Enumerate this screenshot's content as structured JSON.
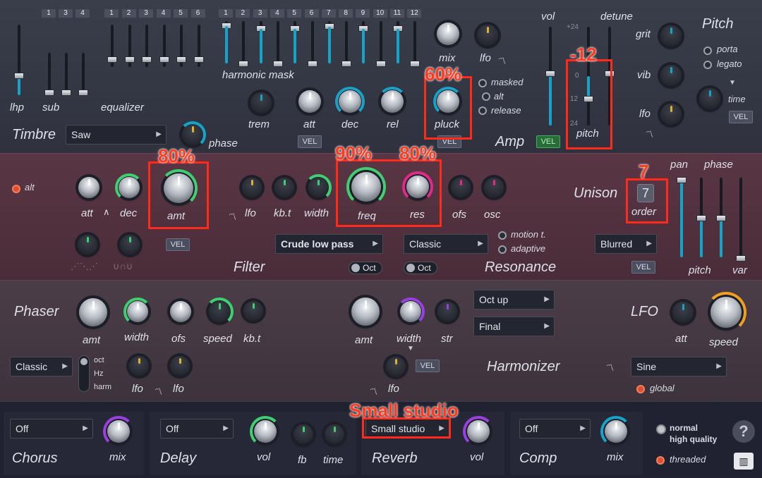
{
  "timbre": {
    "section": "Timbre",
    "lhp": "lhp",
    "sub": "sub",
    "equalizer": "equalizer",
    "harmonic_mask": "harmonic mask",
    "sub_tabs": [
      "1",
      "3",
      "4"
    ],
    "eq_tabs": [
      "1",
      "2",
      "3",
      "4",
      "5",
      "6"
    ],
    "hm_tabs": [
      "1",
      "2",
      "3",
      "4",
      "5",
      "6",
      "7",
      "8",
      "9",
      "10",
      "11",
      "12"
    ],
    "waveform": "Saw",
    "phase": "phase",
    "trem": "trem",
    "att": "att",
    "dec": "dec",
    "rel": "rel",
    "vel": "VEL"
  },
  "amp": {
    "section": "Amp",
    "mix": "mix",
    "lfo": "lfo",
    "pluck": "pluck",
    "masked": "masked",
    "alt": "alt",
    "release": "release",
    "vol": "vol",
    "vel": "VEL",
    "detune": "detune",
    "pitch": "pitch",
    "scale_top": "+24",
    "scale_mid": "+12",
    "scale_zero": "0",
    "scale_neg12": "12",
    "scale_bot": "24"
  },
  "pitch_sec": {
    "section": "Pitch",
    "grit": "grit",
    "vib": "vib",
    "lfo": "lfo",
    "porta": "porta",
    "legato": "legato",
    "time": "time",
    "vel": "VEL"
  },
  "filter": {
    "alt": "alt",
    "att": "att",
    "dec": "dec",
    "amt": "amt",
    "lfo": "lfo",
    "kbt": "kb.t",
    "width": "width",
    "freq": "freq",
    "res": "res",
    "ofs": "ofs",
    "osc": "osc",
    "vel": "VEL",
    "section": "Filter",
    "type": "Crude low pass",
    "oct": "Oct"
  },
  "resonance": {
    "section": "Resonance",
    "mode": "Classic",
    "oct": "Oct",
    "motion": "motion t.",
    "adaptive": "adaptive"
  },
  "unison": {
    "section": "Unison",
    "order_value": "7",
    "order": "order",
    "pan": "pan",
    "phase": "phase",
    "pitch": "pitch",
    "var": "var",
    "mode": "Blurred",
    "vel": "VEL"
  },
  "phaser": {
    "section": "Phaser",
    "amt": "amt",
    "width": "width",
    "ofs": "ofs",
    "speed": "speed",
    "kbt": "kb.t",
    "mode": "Classic",
    "oct": "oct",
    "hz": "Hz",
    "harm": "harm",
    "lfo": "lfo",
    "lfo2": "lfo"
  },
  "harmonizer": {
    "section": "Harmonizer",
    "amt": "amt",
    "width": "width",
    "str": "str",
    "lfo": "lfo",
    "vel": "VEL",
    "mode1": "Oct up",
    "mode2": "Final"
  },
  "lfo": {
    "section": "LFO",
    "att": "att",
    "speed": "speed",
    "shape": "Sine",
    "global": "global"
  },
  "fx": {
    "chorus": "Chorus",
    "chorus_val": "Off",
    "mix": "mix",
    "delay": "Delay",
    "delay_val": "Off",
    "vol": "vol",
    "fb": "fb",
    "time": "time",
    "reverb": "Reverb",
    "reverb_val": "Small studio",
    "rvol": "vol",
    "comp": "Comp",
    "comp_val": "Off",
    "cmix": "mix",
    "normal": "normal",
    "high_quality": "high quality",
    "threaded": "threaded",
    "help": "?"
  },
  "annotations": {
    "pluck": "60%",
    "pitch": "-12",
    "amt": "80%",
    "freq": "90%",
    "res": "80%",
    "order": "7",
    "reverb": "Small studio"
  },
  "colors": {
    "accent_cyan": "#17a3c8",
    "accent_green": "#3fcf70",
    "accent_pink": "#e02a8a",
    "accent_purple": "#9a3fe0",
    "accent_orange": "#f0a020",
    "annotation_red": "#ff2a1a"
  }
}
